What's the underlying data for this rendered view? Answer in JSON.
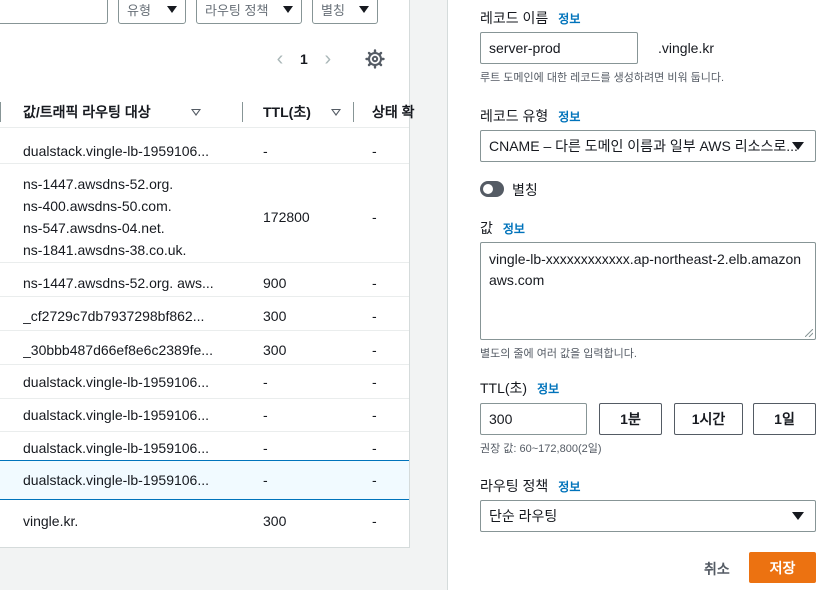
{
  "filters": {
    "type_label": "유형",
    "routing_policy_label": "라우팅 정책",
    "alias_label": "별칭"
  },
  "pagination": {
    "current_page": "1"
  },
  "table": {
    "columns": [
      "값/트래픽 라우팅 대상",
      "TTL(초)",
      "상태 확"
    ],
    "rows": [
      {
        "value": "dualstack.vingle-lb-1959106...",
        "ttl": "-",
        "health": "-"
      },
      {
        "value_lines": [
          "ns-1447.awsdns-52.org.",
          "ns-400.awsdns-50.com.",
          "ns-547.awsdns-04.net.",
          "ns-1841.awsdns-38.co.uk."
        ],
        "ttl": "172800",
        "health": "-"
      },
      {
        "value": "ns-1447.awsdns-52.org. aws...",
        "ttl": "900",
        "health": "-"
      },
      {
        "value": "_cf2729c7db7937298bf862...",
        "ttl": "300",
        "health": "-"
      },
      {
        "value": "_30bbb487d66ef8e6c2389fe...",
        "ttl": "300",
        "health": "-"
      },
      {
        "value": "dualstack.vingle-lb-1959106...",
        "ttl": "-",
        "health": "-"
      },
      {
        "value": "dualstack.vingle-lb-1959106...",
        "ttl": "-",
        "health": "-"
      },
      {
        "value": "dualstack.vingle-lb-1959106...",
        "ttl": "-",
        "health": "-"
      },
      {
        "value": "dualstack.vingle-lb-1959106...",
        "ttl": "-",
        "health": "-"
      },
      {
        "value": "vingle.kr.",
        "ttl": "300",
        "health": "-"
      }
    ]
  },
  "form": {
    "info_label": "정보",
    "record_name_label": "레코드 이름",
    "record_name_value": "server-prod",
    "domain_suffix": ".vingle.kr",
    "record_name_hint": "루트 도메인에 대한 레코드를 생성하려면 비워 둡니다.",
    "record_type_label": "레코드 유형",
    "record_type_value": "CNAME – 다른 도메인 이름과 일부 AWS 리소스로...",
    "alias_label": "별칭",
    "alias_enabled": false,
    "value_label": "값",
    "value_text": "vingle-lb-xxxxxxxxxxxx.ap-northeast-2.elb.amazonaws.com",
    "value_hint": "별도의 줄에 여러 값을 입력합니다.",
    "ttl_label": "TTL(초)",
    "ttl_value": "300",
    "ttl_buttons": [
      "1분",
      "1시간",
      "1일"
    ],
    "ttl_hint": "권장 값: 60~172,800(2일)",
    "routing_policy_label": "라우팅 정책",
    "routing_policy_value": "단순 라우팅",
    "cancel_label": "취소",
    "save_label": "저장"
  },
  "colors": {
    "accent_link": "#0073bb",
    "primary_button": "#ec7211",
    "selected_row_border": "#0073bb"
  }
}
